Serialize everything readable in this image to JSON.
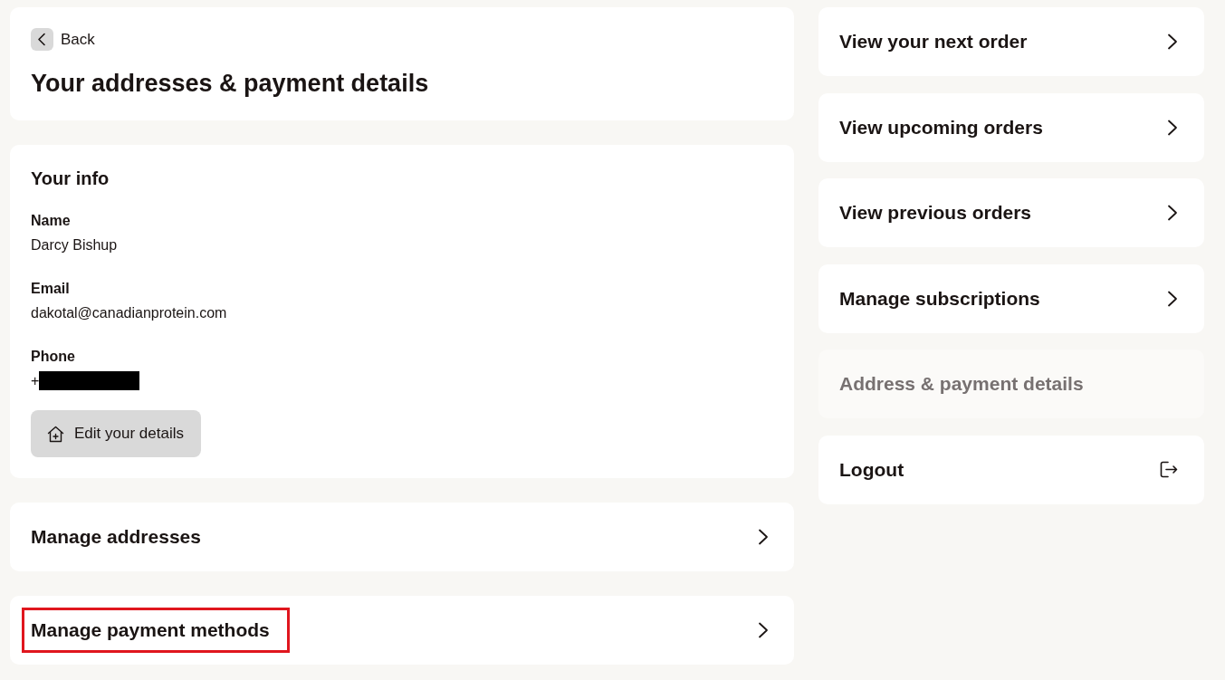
{
  "header": {
    "back_label": "Back",
    "title": "Your addresses & payment details"
  },
  "info": {
    "title": "Your info",
    "fields": [
      {
        "label": "Name",
        "value": "Darcy Bishup",
        "redacted": false
      },
      {
        "label": "Email",
        "value": "dakotal@canadianprotein.com",
        "redacted": false
      },
      {
        "label": "Phone",
        "value": "+",
        "redacted": true
      }
    ],
    "edit_button": "Edit your details"
  },
  "links": [
    {
      "label": "Manage addresses",
      "highlighted": false
    },
    {
      "label": "Manage payment methods",
      "highlighted": true
    }
  ],
  "nav": [
    {
      "label": "View your next order",
      "kind": "link",
      "selected": false
    },
    {
      "label": "View upcoming orders",
      "kind": "link",
      "selected": false
    },
    {
      "label": "View previous orders",
      "kind": "link",
      "selected": false
    },
    {
      "label": "Manage subscriptions",
      "kind": "link",
      "selected": false
    },
    {
      "label": "Address & payment details",
      "kind": "link",
      "selected": true
    },
    {
      "label": "Logout",
      "kind": "logout",
      "selected": false
    }
  ]
}
